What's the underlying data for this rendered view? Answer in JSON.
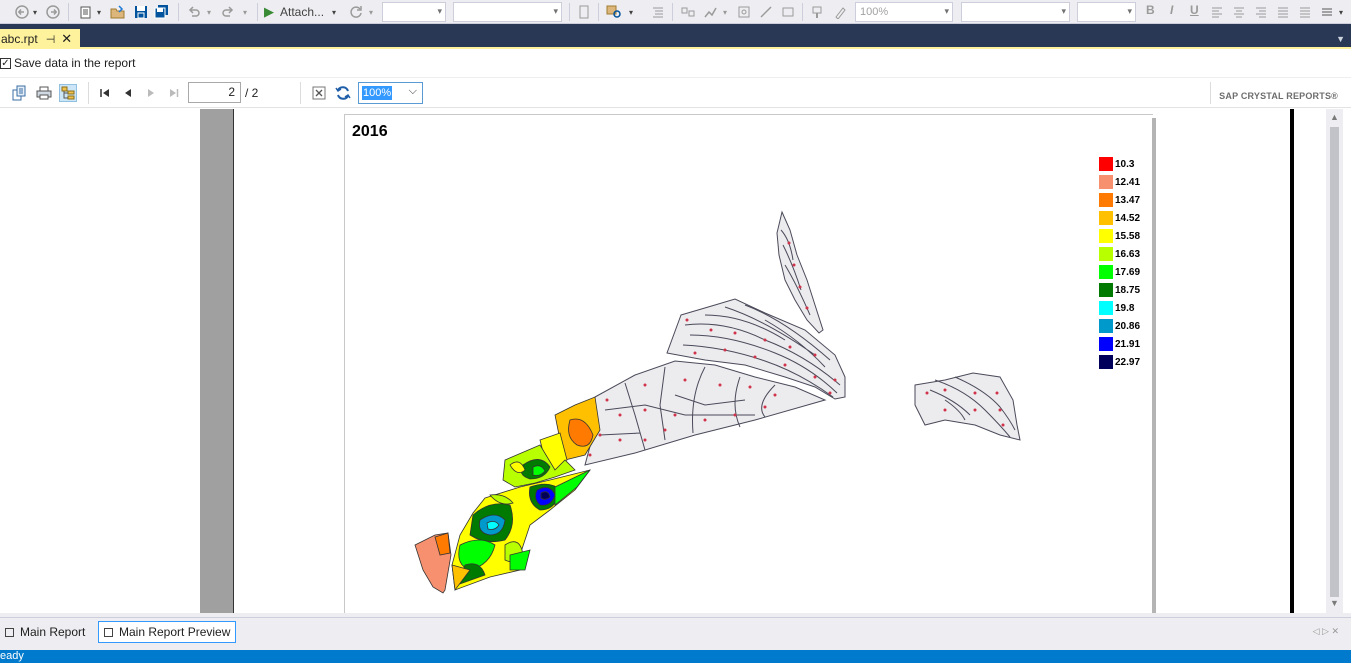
{
  "toolbar": {
    "attach_label": "Attach...",
    "zoom_value": "100%",
    "format_bold": "B",
    "format_italic": "I",
    "format_underline": "U"
  },
  "document_tab": {
    "label": "abc.rpt",
    "pin": "⊣",
    "close": "✕"
  },
  "save_data": {
    "label": "Save data in the report",
    "checked": true
  },
  "viewer": {
    "page_current": "2",
    "page_total": "/ 2",
    "zoom": "100%",
    "brand": "SAP CRYSTAL REPORTS®"
  },
  "report": {
    "title": "2016",
    "legend": [
      {
        "label": "10.3",
        "color": "#ff0000"
      },
      {
        "label": "12.41",
        "color": "#f7906e"
      },
      {
        "label": "13.47",
        "color": "#ff7a00"
      },
      {
        "label": "14.52",
        "color": "#ffc000"
      },
      {
        "label": "15.58",
        "color": "#ffff00"
      },
      {
        "label": "16.63",
        "color": "#b8ff00"
      },
      {
        "label": "17.69",
        "color": "#00ff00"
      },
      {
        "label": "18.75",
        "color": "#007a00"
      },
      {
        "label": "19.8",
        "color": "#00ffff"
      },
      {
        "label": "20.86",
        "color": "#0099cc"
      },
      {
        "label": "21.91",
        "color": "#0000ff"
      },
      {
        "label": "22.97",
        "color": "#00005a"
      }
    ]
  },
  "bottom_tabs": [
    {
      "label": "Main Report"
    },
    {
      "label": "Main Report Preview"
    }
  ],
  "status": {
    "text": "eady"
  }
}
